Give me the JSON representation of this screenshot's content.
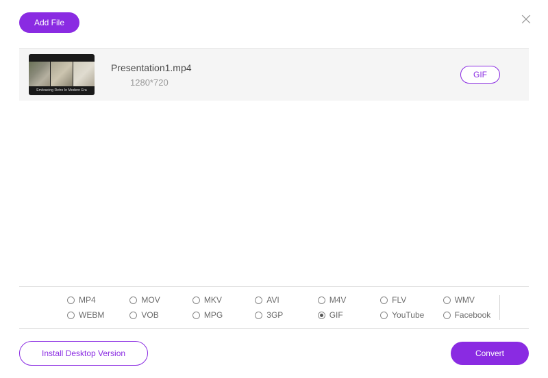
{
  "colors": {
    "accent": "#8a2be2"
  },
  "header": {
    "add_file_label": "Add File"
  },
  "files": [
    {
      "name": "Presentation1.mp4",
      "resolution": "1280*720",
      "output_format": "GIF",
      "thumb_caption": "Embracing Retro In Modern Era"
    }
  ],
  "formats": {
    "options": [
      "MP4",
      "MOV",
      "MKV",
      "AVI",
      "M4V",
      "FLV",
      "WMV",
      "WEBM",
      "VOB",
      "MPG",
      "3GP",
      "GIF",
      "YouTube",
      "Facebook"
    ],
    "selected": "GIF"
  },
  "footer": {
    "install_label": "Install Desktop Version",
    "convert_label": "Convert"
  }
}
